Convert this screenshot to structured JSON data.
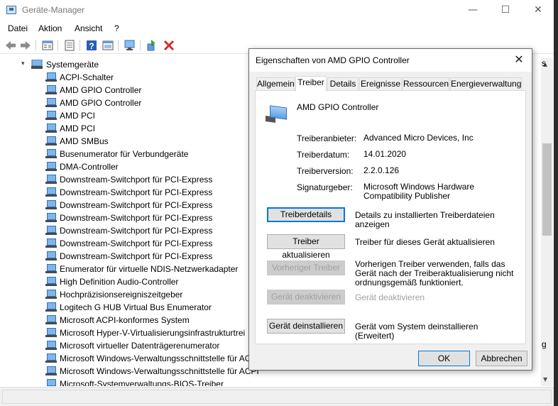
{
  "window": {
    "title": "Geräte-Manager",
    "minimize_glyph": "—",
    "maximize_glyph": "☐",
    "close_glyph": "✕"
  },
  "menu": [
    "Datei",
    "Aktion",
    "Ansicht",
    "?"
  ],
  "toolbar_icons": [
    "back-icon",
    "forward-icon",
    "properties-icon",
    "driver-icon",
    "help-icon",
    "view-icon",
    "scan-hardware-icon",
    "enable-device-icon",
    "uninstall-icon"
  ],
  "tree": {
    "root": "Systemgeräte",
    "items": [
      "ACPI-Schalter",
      "AMD GPIO Controller",
      "AMD GPIO Controller",
      "AMD PCI",
      "AMD PCI",
      "AMD SMBus",
      "Busenumerator für Verbundgeräte",
      "DMA-Controller",
      "Downstream-Switchport für PCI-Express",
      "Downstream-Switchport für PCI-Express",
      "Downstream-Switchport für PCI-Express",
      "Downstream-Switchport für PCI-Express",
      "Downstream-Switchport für PCI-Express",
      "Downstream-Switchport für PCI-Express",
      "Downstream-Switchport für PCI-Express",
      "Enumerator für virtuelle NDIS-Netzwerkadapter",
      "High Definition Audio-Controller",
      "Hochpräzisionsereigniszeitgeber",
      "Logitech G HUB Virtual Bus Enumerator",
      "Microsoft ACPI-konformes System",
      "Microsoft Hyper-V-Virtualisierungsinfrastrukturtrei",
      "Microsoft virtueller Datenträgerenumerator",
      "Microsoft Windows-Verwaltungsschnittstelle für AC",
      "Microsoft Windows-Verwaltungsschnittstelle für ACPI",
      "Microsoft-Systemverwaltungs-BIOS-Treiber"
    ]
  },
  "background_peek": [
    "s",
    "g"
  ],
  "dialog": {
    "title": "Eigenschaften von AMD GPIO Controller",
    "close_glyph": "✕",
    "tabs": [
      "Allgemein",
      "Treiber",
      "Details",
      "Ereignisse",
      "Ressourcen",
      "Energieverwaltung"
    ],
    "active_tab": "Treiber",
    "device_name": "AMD GPIO Controller",
    "properties": [
      {
        "label": "Treiberanbieter:",
        "value": "Advanced Micro Devices, Inc"
      },
      {
        "label": "Treiberdatum:",
        "value": "14.01.2020"
      },
      {
        "label": "Treiberversion:",
        "value": "2.2.0.126"
      },
      {
        "label": "Signaturgeber:",
        "value": "Microsoft Windows Hardware Compatibility Publisher"
      }
    ],
    "actions": [
      {
        "button": "Treiberdetails",
        "description": "Details zu installierten Treiberdateien anzeigen",
        "enabled": true
      },
      {
        "button": "Treiber aktualisieren",
        "description": "Treiber für dieses Gerät aktualisieren",
        "enabled": true
      },
      {
        "button": "Vorheriger Treiber",
        "description": "Vorherigen Treiber verwenden, falls das Gerät nach der Treiberaktualisierung nicht ordnungsgemäß funktioniert.",
        "enabled": false
      },
      {
        "button": "Gerät deaktivieren",
        "description": "Gerät deaktivieren",
        "enabled": false
      },
      {
        "button": "Gerät deinstallieren",
        "description": "Gerät vom System deinstallieren (Erweitert)",
        "enabled": true
      }
    ],
    "ok_label": "OK",
    "cancel_label": "Abbrechen"
  },
  "colors": {
    "accent": "#0078d7",
    "device_icon_blue": "#7fb6ea",
    "remove_red": "#d32f2f",
    "enable_green": "#2e9e3a"
  }
}
